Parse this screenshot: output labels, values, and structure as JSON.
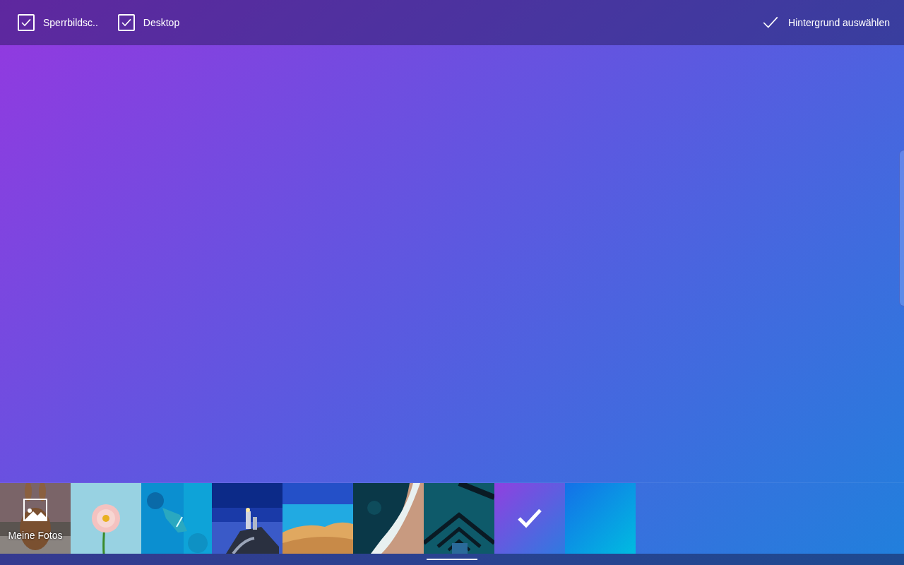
{
  "toolbar": {
    "checkboxes": [
      {
        "label": "Sperrbildsc..",
        "checked": true
      },
      {
        "label": "Desktop",
        "checked": true
      }
    ],
    "apply_button": {
      "label": "Hintergrund auswählen"
    }
  },
  "thumbnails": [
    {
      "kind": "photos",
      "label": "Meine Fotos",
      "selected": false
    },
    {
      "kind": "picture",
      "selected": false
    },
    {
      "kind": "picture",
      "selected": false
    },
    {
      "kind": "picture",
      "selected": false
    },
    {
      "kind": "picture",
      "selected": false
    },
    {
      "kind": "picture",
      "selected": false
    },
    {
      "kind": "picture",
      "selected": false
    },
    {
      "kind": "violet",
      "selected": true
    },
    {
      "kind": "azure",
      "selected": false
    }
  ]
}
